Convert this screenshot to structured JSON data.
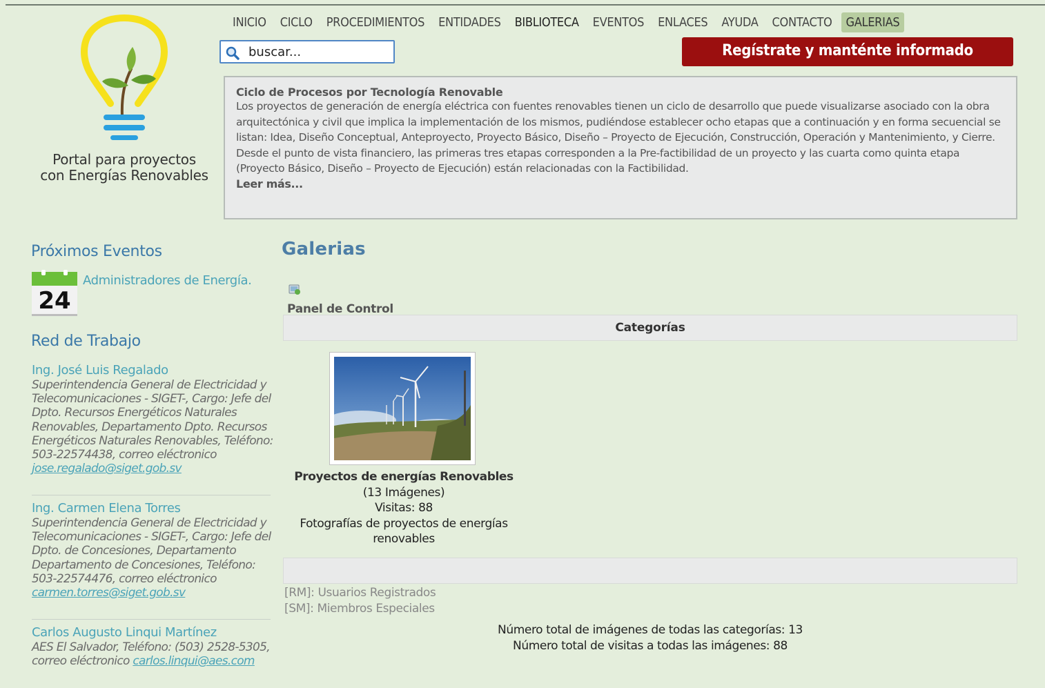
{
  "nav": {
    "items": [
      {
        "label": "INICIO"
      },
      {
        "label": "CICLO"
      },
      {
        "label": "PROCEDIMIENTOS"
      },
      {
        "label": "ENTIDADES"
      },
      {
        "label": "BIBLIOTECA"
      },
      {
        "label": "EVENTOS"
      },
      {
        "label": "ENLACES"
      },
      {
        "label": "AYUDA"
      },
      {
        "label": "CONTACTO"
      },
      {
        "label": "GALERIAS"
      }
    ],
    "active": "GALERIAS"
  },
  "logo": {
    "line1": "Portal para proyectos",
    "line2": "con Energías Renovables"
  },
  "search": {
    "value": "buscar..."
  },
  "register_label": "Regístrate y manténte informado",
  "intro": {
    "title": "Ciclo de Procesos por Tecnología Renovable",
    "body": "Los proyectos de generación de energía eléctrica con fuentes renovables tienen un ciclo de desarrollo que puede visualizarse asociado con la obra arquitectónica y civil que implica la implementación de los mismos, pudiéndose establecer ocho etapas que a continuación y en forma secuencial se listan: Idea, Diseño Conceptual, Anteproyecto, Proyecto Básico, Diseño – Proyecto de Ejecución, Construcción, Operación y Mantenimiento, y Cierre. Desde el punto de vista financiero, las primeras tres etapas corresponden a la Pre-factibilidad de un proyecto y las cuarta como quinta etapa (Proyecto Básico, Diseño – Proyecto de Ejecución) están relacionadas con la Factibilidad.",
    "read_more": "Leer más..."
  },
  "sidebar": {
    "events_heading": "Próximos Eventos",
    "event": {
      "day": "24",
      "title": "Administradores de Energía."
    },
    "network_heading": "Red de Trabajo",
    "contacts": [
      {
        "name": "Ing. José Luis Regalado",
        "desc": "Superintendencia General de Electricidad y Telecomunicaciones - SIGET-, Cargo: Jefe del Dpto. Recursos Energéticos Naturales Renovables, Departamento Dpto. Recursos Energéticos Naturales Renovables, Teléfono: 503-22574438, correo eléctronico ",
        "email": "jose.regalado@siget.gob.sv"
      },
      {
        "name": "Ing. Carmen Elena Torres",
        "desc": "Superintendencia General de Electricidad y Telecomunicaciones - SIGET-, Cargo: Jefe del Dpto. de Concesiones, Departamento Departamento de Concesiones, Teléfono: 503-22574476, correo eléctronico ",
        "email": "carmen.torres@siget.gob.sv"
      },
      {
        "name": "Carlos Augusto Linqui Martínez",
        "desc": "AES El Salvador, Teléfono: (503) 2528-5305, correo eléctronico ",
        "email": "carlos.linqui@aes.com"
      }
    ]
  },
  "main": {
    "title": "Galerias",
    "panel_label": "Panel de Control",
    "categories_label": "Categorías",
    "gallery": {
      "title": "Proyectos de energías Renovables",
      "images": "(13 Imágenes)",
      "visits": "Visitas: 88",
      "description": "Fotografías de proyectos de energías renovables"
    },
    "legend": [
      "[RM]: Usuarios Registrados",
      "[SM]: Miembros Especiales"
    ],
    "totals": [
      "Número total de imágenes de todas las categorías: 13",
      "Número total de visitas a todas las imágenes: 88"
    ]
  },
  "colors": {
    "background": "#e4eedc",
    "accent_blue": "#3b78a8",
    "link": "#4aa3b8",
    "register_button": "#9b0f0f",
    "active_tab": "#b7cda0"
  },
  "icons": [
    "lightbulb-logo-icon",
    "search-icon",
    "calendar-icon",
    "control-panel-icon"
  ]
}
